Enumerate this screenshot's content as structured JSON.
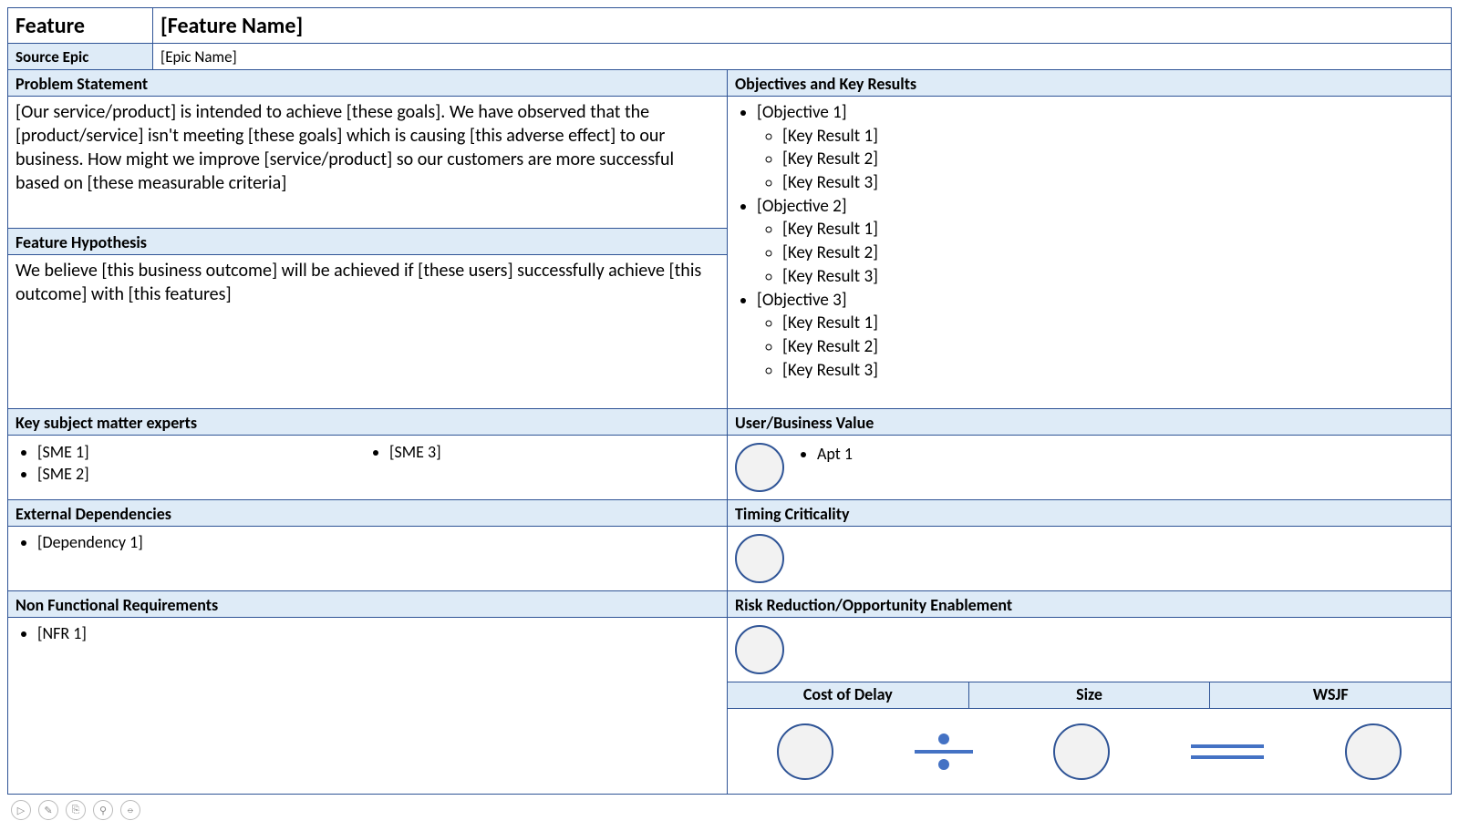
{
  "title": {
    "label": "Feature",
    "value": "[Feature Name]"
  },
  "source_epic": {
    "label": "Source Epic",
    "value": "[Epic Name]"
  },
  "problem": {
    "label": "Problem Statement",
    "text": "[Our service/product] is intended to achieve [these goals].  We have observed that the [product/service] isn't meeting [these goals] which is causing [this adverse effect] to our business.  How might we improve [service/product] so our customers are more successful based on [these measurable criteria]"
  },
  "hypothesis": {
    "label": "Feature Hypothesis",
    "text": "We believe [this business outcome] will be achieved if [these users] successfully achieve [this outcome] with [this features]"
  },
  "okr": {
    "label": "Objectives and Key Results",
    "objectives": [
      {
        "name": "[Objective 1]",
        "krs": [
          "[Key Result 1]",
          "[Key Result 2]",
          "[Key Result 3]"
        ]
      },
      {
        "name": "[Objective 2]",
        "krs": [
          "[Key Result 1]",
          "[Key Result 2]",
          "[Key Result 3]"
        ]
      },
      {
        "name": "[Objective 3]",
        "krs": [
          "[Key Result 1]",
          "[Key Result 2]",
          "[Key Result 3]"
        ]
      }
    ]
  },
  "sme": {
    "label": "Key subject matter experts",
    "col1": [
      "[SME 1]",
      "[SME 2]"
    ],
    "col2": [
      "[SME 3]"
    ]
  },
  "deps": {
    "label": "External Dependencies",
    "items": [
      "[Dependency 1]"
    ]
  },
  "nfr": {
    "label": "Non Functional Requirements",
    "items": [
      "[NFR 1]"
    ]
  },
  "ubv": {
    "label": "User/Business Value",
    "items": [
      "Apt 1"
    ]
  },
  "tc": {
    "label": "Timing Criticality"
  },
  "rroe": {
    "label": "Risk Reduction/Opportunity Enablement"
  },
  "metrics": {
    "cod": "Cost of Delay",
    "size": "Size",
    "wsjf": "WSJF"
  },
  "toolbar": {
    "b1": "▷",
    "b2": "✎",
    "b3": "⎘",
    "b4": "⚲",
    "b5": "⦵"
  }
}
